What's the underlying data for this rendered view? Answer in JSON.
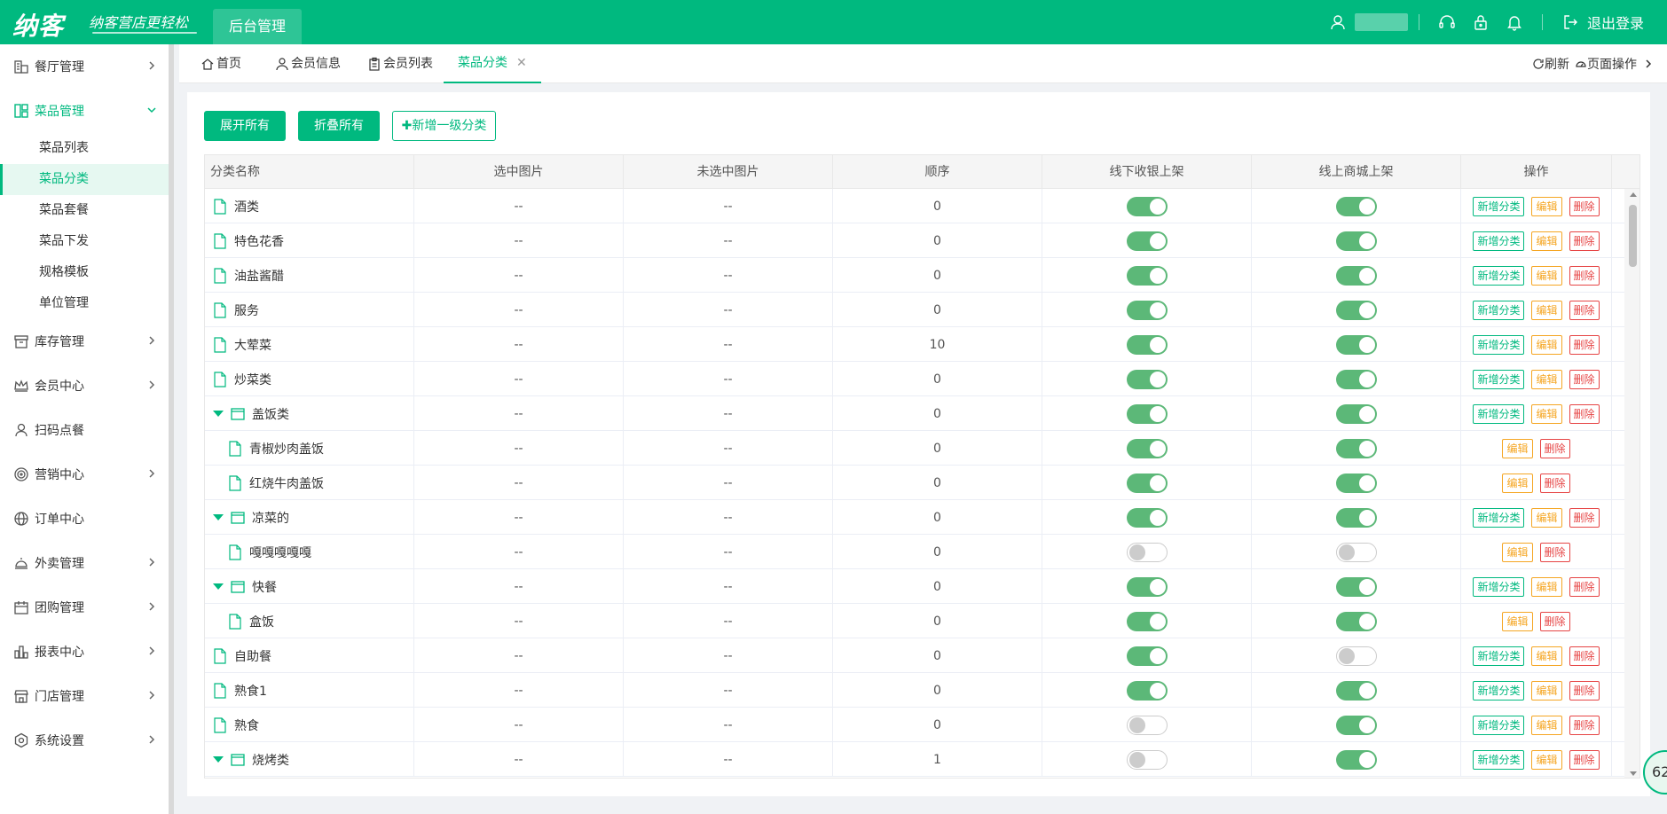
{
  "header": {
    "logo": "纳客",
    "slogan": "纳客营店更轻松",
    "active_tab": "后台管理",
    "logout": "退出登录"
  },
  "sidebar": {
    "items": [
      {
        "label": "餐厅管理",
        "icon": "restaurant-icon"
      },
      {
        "label": "菜品管理",
        "icon": "dish-grid-icon"
      },
      {
        "label": "库存管理",
        "icon": "inventory-icon"
      },
      {
        "label": "会员中心",
        "icon": "crown-icon"
      },
      {
        "label": "扫码点餐",
        "icon": "user-icon"
      },
      {
        "label": "营销中心",
        "icon": "target-icon"
      },
      {
        "label": "订单中心",
        "icon": "globe-icon"
      },
      {
        "label": "外卖管理",
        "icon": "bell-cover-icon"
      },
      {
        "label": "团购管理",
        "icon": "calendar-icon"
      },
      {
        "label": "报表中心",
        "icon": "bar-chart-icon"
      },
      {
        "label": "门店管理",
        "icon": "store-icon"
      },
      {
        "label": "系统设置",
        "icon": "gear-icon"
      }
    ],
    "sub_items": [
      "菜品列表",
      "菜品分类",
      "菜品套餐",
      "菜品下发",
      "规格模板",
      "单位管理"
    ]
  },
  "tabs": {
    "home": "首页",
    "member_info": "会员信息",
    "member_list": "会员列表",
    "dish_category": "菜品分类",
    "refresh": "刷新",
    "page_ops": "页面操作"
  },
  "toolbar": {
    "expand_all": "展开所有",
    "collapse_all": "折叠所有",
    "add_top": "✚新增一级分类"
  },
  "table": {
    "headers": [
      "分类名称",
      "选中图片",
      "未选中图片",
      "顺序",
      "线下收银上架",
      "线上商城上架",
      "操作"
    ],
    "op_add": "新增分类",
    "op_edit": "编辑",
    "op_delete": "删除",
    "rows": [
      {
        "name": "酒类",
        "level": 0,
        "group": false,
        "img1": "--",
        "img2": "--",
        "order": "0",
        "offline": true,
        "online": true
      },
      {
        "name": "特色花香",
        "level": 0,
        "group": false,
        "img1": "--",
        "img2": "--",
        "order": "0",
        "offline": true,
        "online": true
      },
      {
        "name": "油盐酱醋",
        "level": 0,
        "group": false,
        "img1": "--",
        "img2": "--",
        "order": "0",
        "offline": true,
        "online": true
      },
      {
        "name": "服务",
        "level": 0,
        "group": false,
        "img1": "--",
        "img2": "--",
        "order": "0",
        "offline": true,
        "online": true
      },
      {
        "name": "大荤菜",
        "level": 0,
        "group": false,
        "img1": "--",
        "img2": "--",
        "order": "10",
        "offline": true,
        "online": true
      },
      {
        "name": "炒菜类",
        "level": 0,
        "group": false,
        "img1": "--",
        "img2": "--",
        "order": "0",
        "offline": true,
        "online": true
      },
      {
        "name": "盖饭类",
        "level": 0,
        "group": true,
        "img1": "--",
        "img2": "--",
        "order": "0",
        "offline": true,
        "online": true
      },
      {
        "name": "青椒炒肉盖饭",
        "level": 1,
        "group": false,
        "img1": "--",
        "img2": "--",
        "order": "0",
        "offline": true,
        "online": true
      },
      {
        "name": "红烧牛肉盖饭",
        "level": 1,
        "group": false,
        "img1": "--",
        "img2": "--",
        "order": "0",
        "offline": true,
        "online": true
      },
      {
        "name": "凉菜的",
        "level": 0,
        "group": true,
        "img1": "--",
        "img2": "--",
        "order": "0",
        "offline": true,
        "online": true
      },
      {
        "name": "嘎嘎嘎嘎嘎",
        "level": 1,
        "group": false,
        "img1": "--",
        "img2": "--",
        "order": "0",
        "offline": false,
        "online": false
      },
      {
        "name": "快餐",
        "level": 0,
        "group": true,
        "img1": "--",
        "img2": "--",
        "order": "0",
        "offline": true,
        "online": true
      },
      {
        "name": "盒饭",
        "level": 1,
        "group": false,
        "img1": "--",
        "img2": "--",
        "order": "0",
        "offline": true,
        "online": true
      },
      {
        "name": "自助餐",
        "level": 0,
        "group": false,
        "img1": "--",
        "img2": "--",
        "order": "0",
        "offline": true,
        "online": false
      },
      {
        "name": "熟食1",
        "level": 0,
        "group": false,
        "img1": "--",
        "img2": "--",
        "order": "0",
        "offline": true,
        "online": true
      },
      {
        "name": "熟食",
        "level": 0,
        "group": false,
        "img1": "--",
        "img2": "--",
        "order": "0",
        "offline": false,
        "online": true
      },
      {
        "name": "烧烤类",
        "level": 0,
        "group": true,
        "img1": "--",
        "img2": "--",
        "order": "1",
        "offline": false,
        "online": true
      }
    ]
  },
  "float_badge": "62",
  "colors": {
    "brand": "#00b97f",
    "switch_on": "#5cb878",
    "edit": "#f5a623",
    "delete": "#e64545"
  }
}
